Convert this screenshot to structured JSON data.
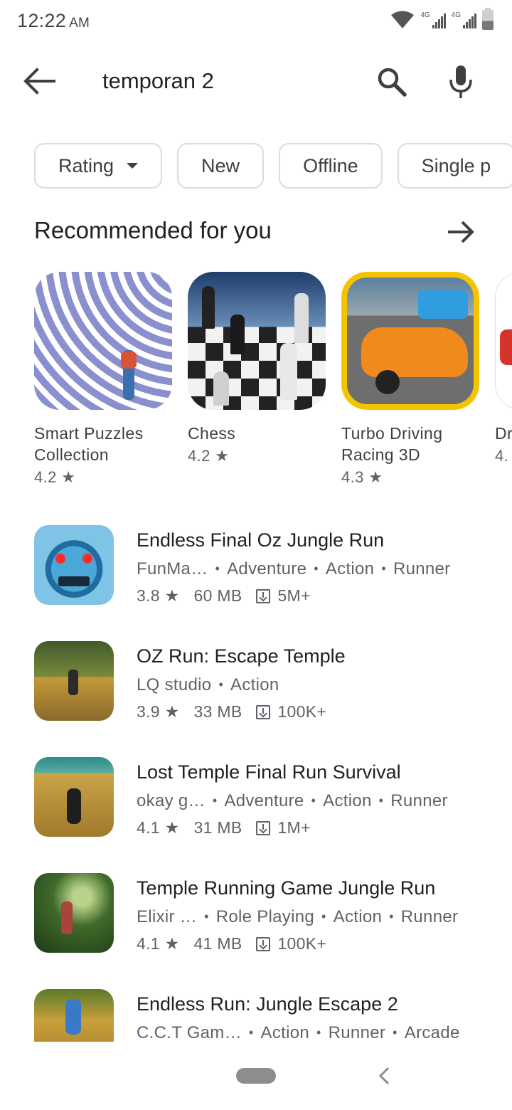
{
  "status_bar": {
    "time": "12:22",
    "ampm": "AM",
    "network_1": "4G",
    "network_2": "4G"
  },
  "search": {
    "query": "temporan 2"
  },
  "chips": [
    "Rating",
    "New",
    "Offline",
    "Single p"
  ],
  "section": {
    "title": "Recommended for you"
  },
  "cards": [
    {
      "name": "Smart Puzzles Collection",
      "rating": "4.2 ★",
      "icon": "maze-icon"
    },
    {
      "name": "Chess",
      "rating": "4.2 ★",
      "icon": "chess-icon"
    },
    {
      "name": "Turbo Driving Racing 3D",
      "rating": "4.3 ★",
      "icon": "race-car-icon"
    },
    {
      "name": "Dr",
      "rating": "4.",
      "icon": "car-icon"
    }
  ],
  "apps": [
    {
      "title": "Endless Final Oz Jungle Run",
      "developer": "FunMa…",
      "genres": [
        "Adventure",
        "Action",
        "Runner"
      ],
      "rating": "3.8 ★",
      "size": "60 MB",
      "downloads": "5M+"
    },
    {
      "title": "OZ Run: Escape Temple",
      "developer": "LQ studio",
      "genres": [
        "Action"
      ],
      "rating": "3.9 ★",
      "size": "33 MB",
      "downloads": "100K+"
    },
    {
      "title": "Lost Temple Final Run Survival",
      "developer": "okay g…",
      "genres": [
        "Adventure",
        "Action",
        "Runner"
      ],
      "rating": "4.1 ★",
      "size": "31 MB",
      "downloads": "1M+"
    },
    {
      "title": "Temple Running Game Jungle Run",
      "developer": "Elixir …",
      "genres": [
        "Role Playing",
        "Action",
        "Runner"
      ],
      "rating": "4.1 ★",
      "size": "41 MB",
      "downloads": "100K+"
    },
    {
      "title": "Endless Run: Jungle Escape 2",
      "developer": "C.C.T Gam…",
      "genres": [
        "Action",
        "Runner",
        "Arcade"
      ],
      "rating": "",
      "size": "",
      "downloads": ""
    }
  ]
}
